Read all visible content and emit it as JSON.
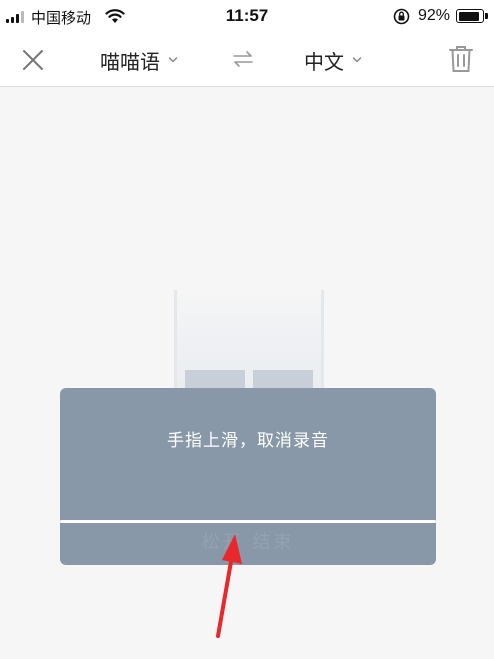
{
  "status_bar": {
    "carrier": "中国移动",
    "time": "11:57",
    "battery_percent": "92%",
    "battery_level": 0.92,
    "icons": [
      "signal-icon",
      "wifi-icon",
      "rotation-lock-icon",
      "battery-icon"
    ]
  },
  "toolbar": {
    "close_icon": "close-icon",
    "source_language": "喵喵语",
    "swap_icon": "swap-icon",
    "target_language": "中文",
    "trash_icon": "trash-icon"
  },
  "overlay": {
    "hint": "手指上滑，取消录音",
    "ghost_text": "松开 结束"
  },
  "colors": {
    "overlay_bg": "#8898a8",
    "annotation_arrow": "#e8282b",
    "page_bg": "#f6f6f6"
  }
}
